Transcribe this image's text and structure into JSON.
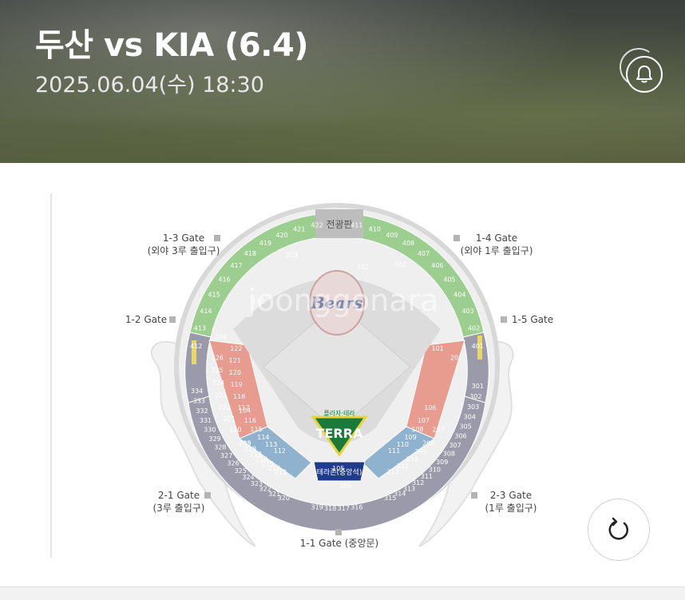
{
  "header": {
    "title": "두산 vs KIA (6.4)",
    "datetime": "2025.06.04(수) 18:30"
  },
  "map": {
    "scoreboard_label": "전광판",
    "logo_text": "Bears",
    "terra_top": "플라자·테라",
    "terra_brand": "TERRA",
    "center_zone": "테라존(중앙석)",
    "watermark": "joonggonara"
  },
  "gates": {
    "g13": {
      "name": "1-3 Gate",
      "sub": "(외야 3루 출입구)"
    },
    "g14": {
      "name": "1-4 Gate",
      "sub": "(외야 1루 출입구)"
    },
    "g12": {
      "name": "1-2 Gate"
    },
    "g15": {
      "name": "1-5 Gate"
    },
    "g21": {
      "name": "2-1 Gate",
      "sub": "(3루 출입구)"
    },
    "g23": {
      "name": "2-3 Gate",
      "sub": "(1루 출입구)"
    },
    "g11": {
      "name": "1-1 Gate (중앙문)"
    }
  },
  "sections": {
    "outfield_left": [
      "412",
      "413",
      "414",
      "415",
      "416",
      "417",
      "418",
      "419",
      "420",
      "421",
      "422"
    ],
    "outfield_right": [
      "411",
      "410",
      "409",
      "408",
      "407",
      "406",
      "405",
      "404",
      "403",
      "402",
      "401"
    ],
    "lower_left_red": [
      "122",
      "121",
      "120",
      "119",
      "118",
      "117"
    ],
    "lower_right_red": [
      "101",
      "102",
      "103",
      "104",
      "105",
      "106"
    ],
    "upper_left_red": [
      "226",
      "225",
      "224",
      "223",
      "222",
      "221",
      "220"
    ],
    "upper_right_red": [
      "201",
      "202",
      "203",
      "204",
      "205",
      "206",
      "207"
    ],
    "lower_left_blue": [
      "116",
      "115",
      "114",
      "113",
      "112"
    ],
    "lower_right_blue": [
      "107",
      "108",
      "109",
      "110",
      "111"
    ],
    "mid_left": [
      "219",
      "218",
      "217",
      "216",
      "215",
      "214",
      "213"
    ],
    "mid_right": [
      "208",
      "209",
      "210",
      "211",
      "212"
    ],
    "upper_left_grey": [
      "334",
      "333",
      "332",
      "331",
      "330",
      "329",
      "328",
      "327",
      "326",
      "325",
      "324",
      "323",
      "322",
      "321",
      "320"
    ],
    "upper_right_grey": [
      "301",
      "302",
      "303",
      "304",
      "305",
      "306",
      "307",
      "308",
      "309",
      "310",
      "311",
      "312",
      "313",
      "314",
      "315"
    ],
    "bottom_grey": [
      "319",
      "318",
      "317",
      "316"
    ]
  },
  "colors": {
    "outfield": "#9ccf8f",
    "red": "#e89c90",
    "blue": "#8fb2cf",
    "grey": "#9a9aab",
    "navy": "#1f3b8a"
  }
}
